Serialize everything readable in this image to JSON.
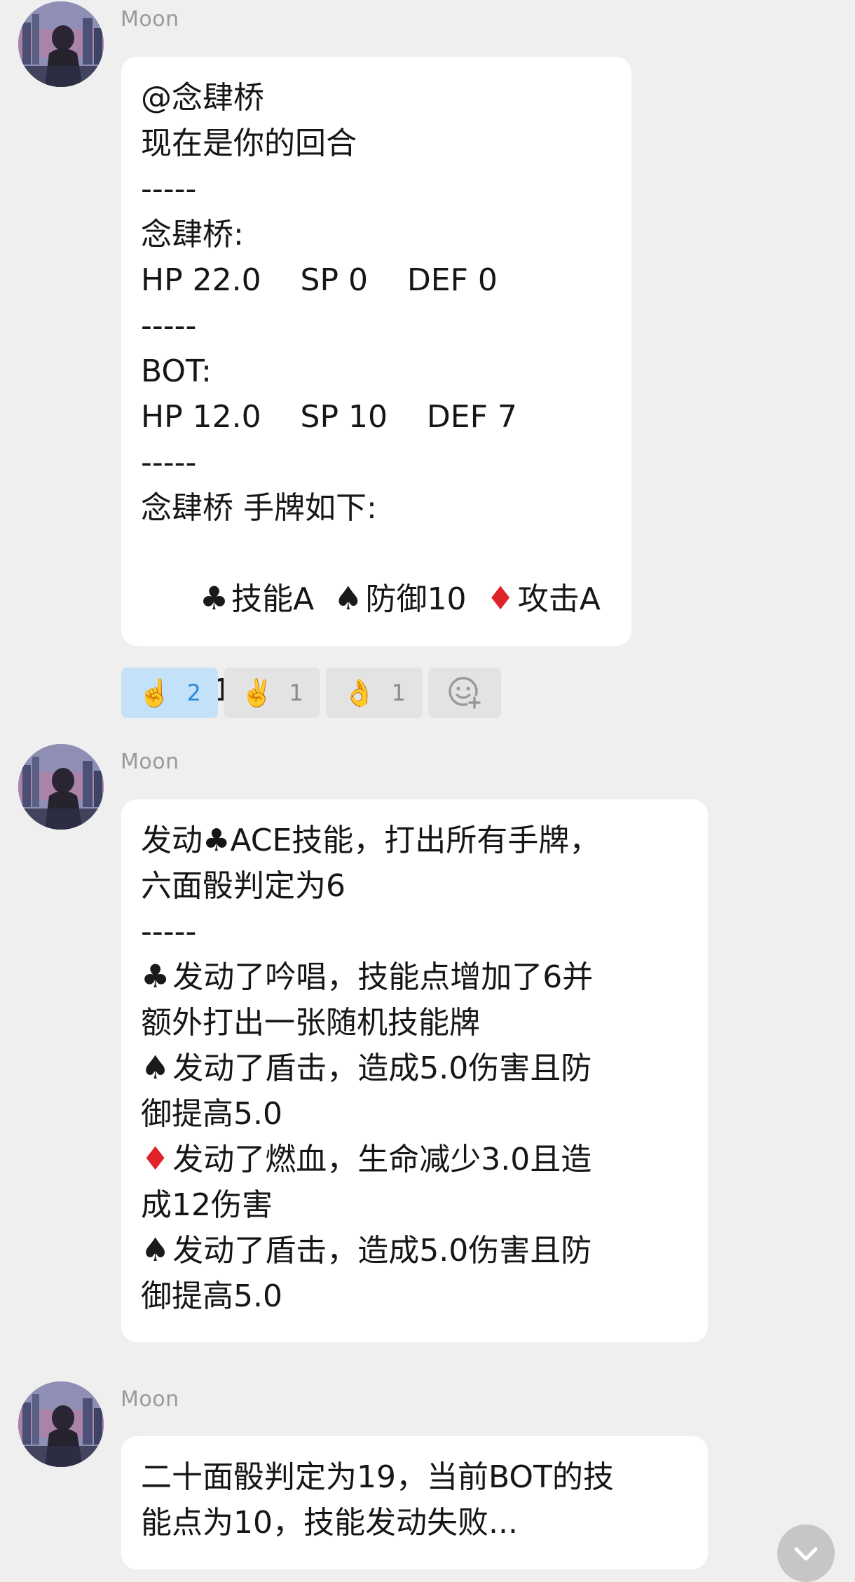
{
  "messages": [
    {
      "sender": "Moon",
      "lines": [
        "@念肆桥",
        "现在是你的回合",
        "-----",
        "念肆桥:",
        "HP 22.0    SP 0    DEF 0",
        "-----",
        "BOT:",
        "HP 12.0    SP 10    DEF 7",
        "-----",
        "念肆桥 手牌如下:"
      ],
      "cards": [
        {
          "suit": "♣",
          "label": "技能A"
        },
        {
          "suit": "♠",
          "label": "防御10"
        },
        {
          "suit": "♦",
          "label": "攻击A"
        }
      ],
      "footer": "出牌 1/2/3",
      "reactions": [
        {
          "icon": "victory-hand-single-icon",
          "emoji": "☝️",
          "count": "2",
          "active": true
        },
        {
          "icon": "victory-hand-icon",
          "emoji": "✌️",
          "count": "1",
          "active": false
        },
        {
          "icon": "ok-hand-icon",
          "emoji": "👌",
          "count": "1",
          "active": false
        }
      ]
    },
    {
      "sender": "Moon",
      "lines": [
        {
          "text": "发动♣ACE技能，打出所有手牌，",
          "suit": null
        },
        {
          "text": "六面骰判定为6",
          "suit": null
        },
        {
          "text": "-----",
          "suit": null
        },
        {
          "text": "发动了吟唱，技能点增加了6并",
          "suit": "♣"
        },
        {
          "text": "额外打出一张随机技能牌",
          "suit": null
        },
        {
          "text": "发动了盾击，造成5.0伤害且防",
          "suit": "♠"
        },
        {
          "text": "御提高5.0",
          "suit": null
        },
        {
          "text": "发动了燃血，生命减少3.0且造",
          "suit": "♦"
        },
        {
          "text": "成12伤害",
          "suit": null
        },
        {
          "text": "发动了盾击，造成5.0伤害且防",
          "suit": "♠"
        },
        {
          "text": "御提高5.0",
          "suit": null
        }
      ]
    },
    {
      "sender": "Moon",
      "lines": [
        "二十面骰判定为19，当前BOT的技",
        "能点为10，技能发动失败..."
      ]
    }
  ],
  "colors": {
    "background": "#efefef",
    "bubble": "#ffffff",
    "sender": "#9a9a9a",
    "red_suit": "#e0222b",
    "reaction_active_bg": "#c3e1f8",
    "reaction_active_count": "#2a8ad8"
  },
  "icons": {
    "add_reaction": "add-reaction-icon",
    "scroll_down": "chevron-down-icon"
  }
}
